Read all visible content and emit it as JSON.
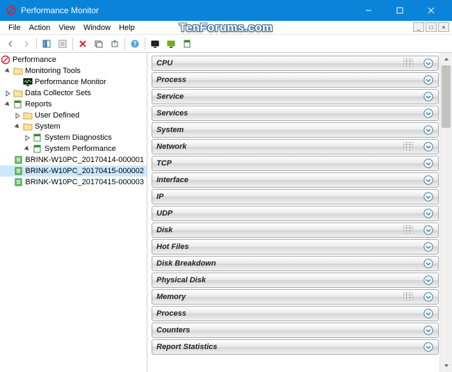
{
  "window": {
    "title": "Performance Monitor"
  },
  "watermark": "TenForums.com",
  "menu": {
    "file": "File",
    "action": "Action",
    "view": "View",
    "window": "Window",
    "help": "Help"
  },
  "tree": {
    "root": "Performance",
    "monitoring_tools": "Monitoring Tools",
    "performance_monitor": "Performance Monitor",
    "data_collector_sets": "Data Collector Sets",
    "reports": "Reports",
    "user_defined": "User Defined",
    "system": "System",
    "system_diagnostics": "System Diagnostics",
    "system_performance": "System Performance",
    "rep0": "BRINK-W10PC_20170414-000001",
    "rep1": "BRINK-W10PC_20170415-000002",
    "rep2": "BRINK-W10PC_20170415-000003"
  },
  "sections": [
    {
      "label": "CPU",
      "table": true
    },
    {
      "label": "Process",
      "table": false
    },
    {
      "label": "Service",
      "table": false
    },
    {
      "label": "Services",
      "table": false
    },
    {
      "label": "System",
      "table": false
    },
    {
      "label": "Network",
      "table": true
    },
    {
      "label": "TCP",
      "table": false
    },
    {
      "label": "Interface",
      "table": false
    },
    {
      "label": "IP",
      "table": false
    },
    {
      "label": "UDP",
      "table": false
    },
    {
      "label": "Disk",
      "table": true
    },
    {
      "label": "Hot Files",
      "table": false
    },
    {
      "label": "Disk Breakdown",
      "table": false
    },
    {
      "label": "Physical Disk",
      "table": false
    },
    {
      "label": "Memory",
      "table": true
    },
    {
      "label": "Process",
      "table": false
    },
    {
      "label": "Counters",
      "table": false
    },
    {
      "label": "Report Statistics",
      "table": false
    }
  ]
}
